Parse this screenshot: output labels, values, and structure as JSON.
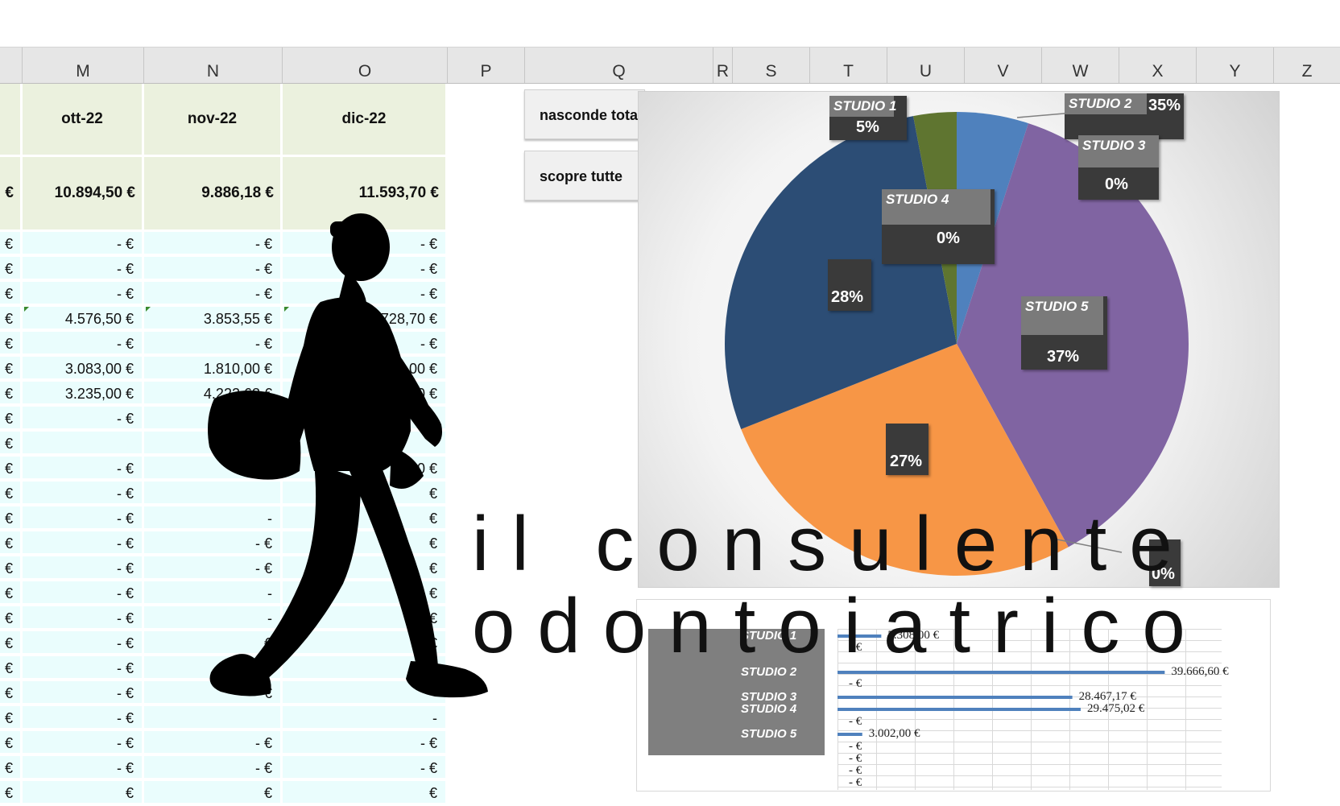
{
  "sheet": {
    "columns": [
      "M",
      "N",
      "O",
      "P",
      "Q",
      "R",
      "S",
      "T",
      "U",
      "V",
      "W",
      "X",
      "Y",
      "Z"
    ],
    "months": [
      "ott-22",
      "nov-22",
      "dic-22"
    ],
    "totals": [
      "10.894,50 €",
      "9.886,18 €",
      "11.593,70 €"
    ],
    "left_totals_fragment": "€",
    "rows": [
      {
        "m": "-   €",
        "n": "-   €",
        "o": "-   €"
      },
      {
        "m": "-   €",
        "n": "-   €",
        "o": "-   €"
      },
      {
        "m": "-   €",
        "n": "-   €",
        "o": "-   €"
      },
      {
        "m": "4.576,50 €",
        "n": "3.853,55 €",
        "o": "728,70 €"
      },
      {
        "m": "-   €",
        "n": "-   €",
        "o": "-   €"
      },
      {
        "m": "3.083,00 €",
        "n": "1.810,00 €",
        "o": "3,00 €"
      },
      {
        "m": "3.235,00 €",
        "n": "4.222,63 €",
        "o": "00 €"
      },
      {
        "m": "-   €",
        "n": "",
        "o": ""
      },
      {
        "m": "",
        "n": "",
        "o": ""
      },
      {
        "m": "-   €",
        "n": "",
        "o": "0 €"
      },
      {
        "m": "-   €",
        "n": "",
        "o": "€"
      },
      {
        "m": "-   €",
        "n": "-",
        "o": "€"
      },
      {
        "m": "-   €",
        "n": "-   €",
        "o": "€"
      },
      {
        "m": "-   €",
        "n": "-   €",
        "o": "€"
      },
      {
        "m": "-   €",
        "n": "-",
        "o": "€"
      },
      {
        "m": "-   €",
        "n": "-",
        "o": "€"
      },
      {
        "m": "-   €",
        "n": "€",
        "o": "€"
      },
      {
        "m": "-   €",
        "n": "€",
        "o": ""
      },
      {
        "m": "-   €",
        "n": "€",
        "o": "-"
      },
      {
        "m": "-   €",
        "n": "",
        "o": "-"
      },
      {
        "m": "-   €",
        "n": "-   €",
        "o": "-   €"
      },
      {
        "m": "-   €",
        "n": "-   €",
        "o": "-   €"
      },
      {
        "m": "€",
        "n": "€",
        "o": "€"
      }
    ],
    "left_fragment": "€"
  },
  "buttons": {
    "hide": "nasconde tota",
    "show": "scopre tutte"
  },
  "pie": {
    "labels": [
      {
        "name": "STUDIO 1",
        "pct": "5%"
      },
      {
        "name": "STUDIO 2",
        "pct": "35%"
      },
      {
        "name": "STUDIO 3",
        "pct": "0%"
      },
      {
        "name": "STUDIO 4",
        "pct": "0%"
      },
      {
        "name": "STUDIO 5",
        "pct": "37%"
      }
    ],
    "extra_pcts": [
      "28%",
      "27%",
      "0%"
    ],
    "overlap_fragments": [
      "0%",
      "3"
    ]
  },
  "chart_data": [
    {
      "type": "pie",
      "categories": [
        "STUDIO 1",
        "STUDIO 2",
        "STUDIO 3",
        "STUDIO 4",
        "STUDIO 5",
        "(unlabeled)",
        "(unlabeled)",
        "(unlabeled)"
      ],
      "values": [
        5,
        0,
        0,
        0,
        37,
        28,
        27,
        3
      ],
      "colors": [
        "#4f81bd",
        "#c0504d",
        "#9bbb59",
        "#8064a2",
        "#8064a2",
        "#2c4d75",
        "#f79646",
        "#5f7530"
      ]
    },
    {
      "type": "bar",
      "categories": [
        "STUDIO 1",
        "",
        "STUDIO 2",
        "",
        "STUDIO 3",
        "STUDIO 4",
        "",
        "STUDIO 5",
        "",
        "",
        "",
        ""
      ],
      "values": [
        5308.0,
        0,
        39666.6,
        0,
        28467.17,
        29475.02,
        0,
        3002.0,
        0,
        0,
        0,
        0
      ],
      "value_labels": [
        "5.308,00 €",
        "-   €",
        "39.666,60 €",
        "-   €",
        "28.467,17 €",
        "29.475,02 €",
        "-   €",
        "3.002,00 €",
        "-   €",
        "-   €",
        "-   €",
        "-   €"
      ],
      "xlim": [
        0,
        41000
      ]
    }
  ],
  "logo": {
    "line1": "il consulente",
    "line2": "odontoiatrico"
  },
  "colors": {
    "header_green": "#ebf1de",
    "cell_cyan": "#eafdfd",
    "pie_blue": "#4f81bd",
    "pie_purple": "#8064a2",
    "pie_orange": "#f79646",
    "pie_navy": "#2c4d75",
    "pie_olive": "#5f7530",
    "bar_blue": "#4f81bd"
  }
}
